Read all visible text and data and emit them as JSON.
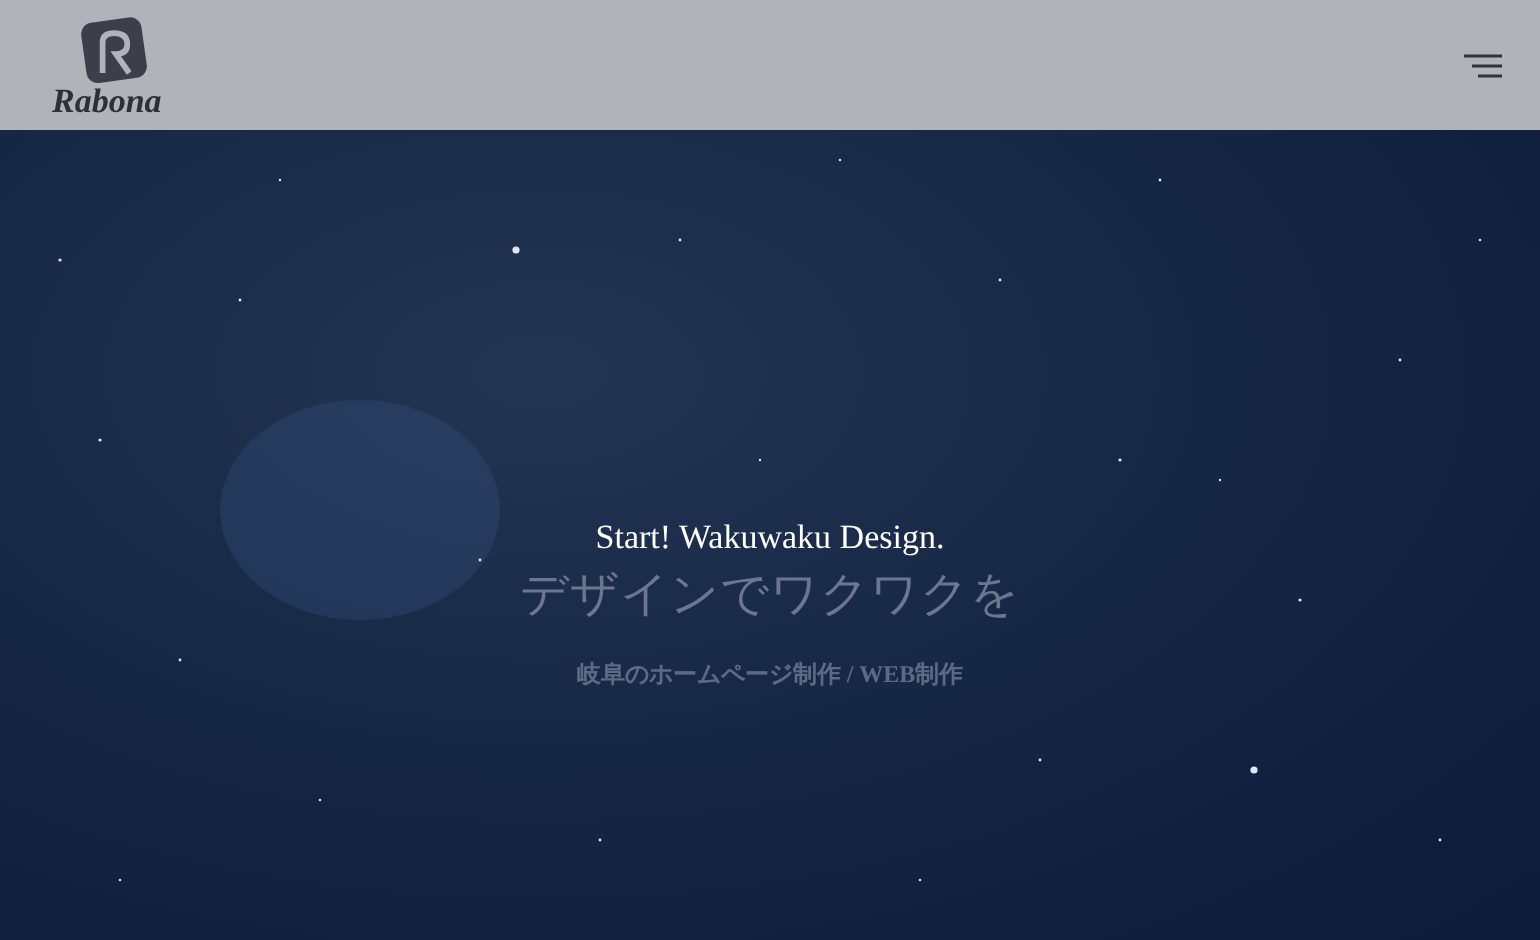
{
  "header": {
    "logo_text": "Rabona"
  },
  "hero": {
    "tagline": "Start! Wakuwaku Design.",
    "headline": "デザインでワクワクを",
    "subtitle": "岐阜のホームページ制作 / WEB制作"
  }
}
